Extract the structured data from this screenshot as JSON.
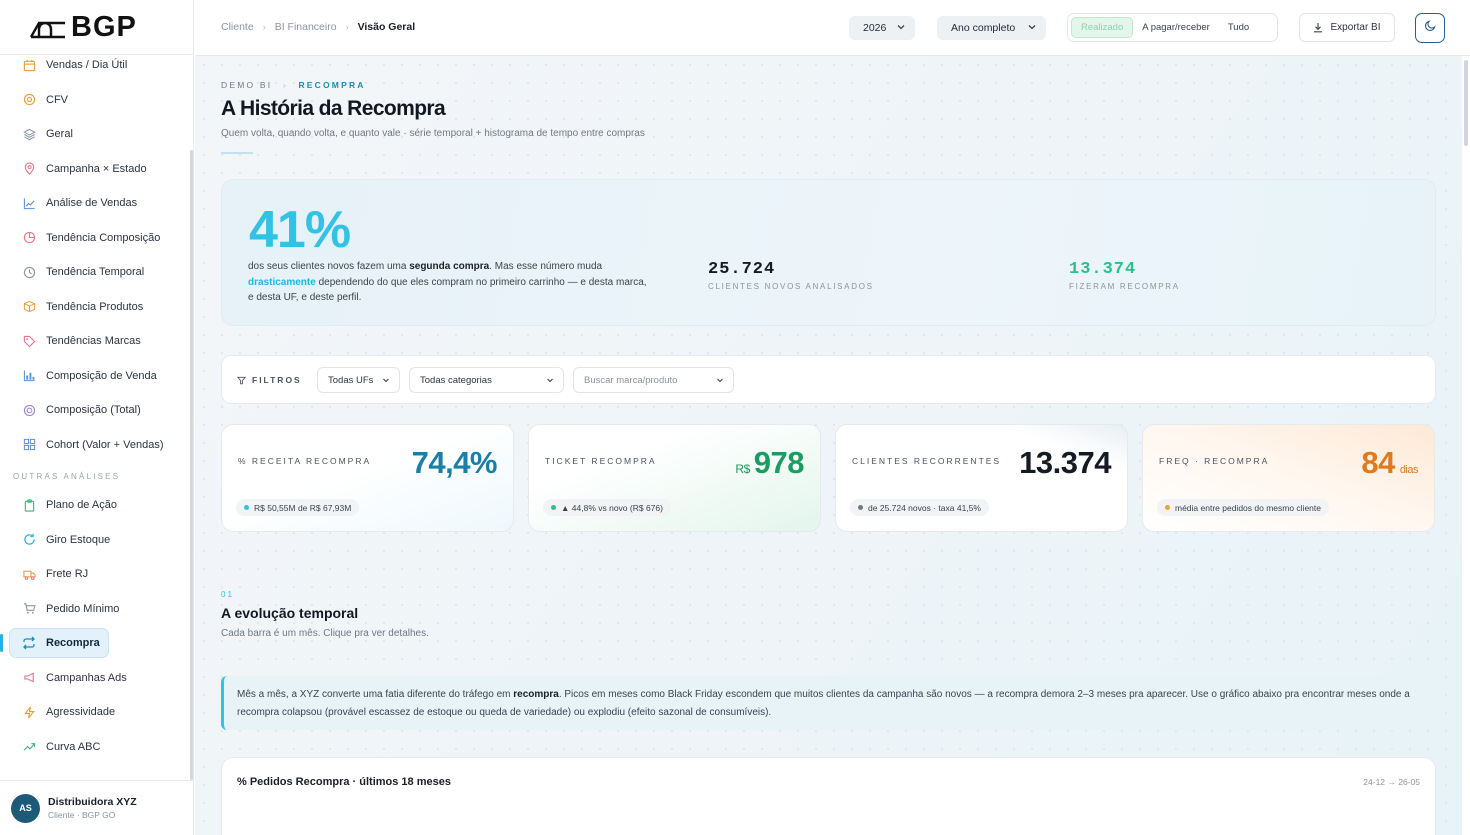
{
  "brand": {
    "logo_text": "BGP"
  },
  "sidebar": {
    "items": [
      {
        "label": "Vendas / Dia Útil",
        "icon": "calendar-icon"
      },
      {
        "label": "CFV",
        "icon": "coin-icon"
      },
      {
        "label": "Geral",
        "icon": "layers-icon"
      },
      {
        "label": "Campanha × Estado",
        "icon": "map-pin-icon"
      },
      {
        "label": "Análise de Vendas",
        "icon": "line-chart-icon"
      },
      {
        "label": "Tendência Composição",
        "icon": "pie-chart-icon"
      },
      {
        "label": "Tendência Temporal",
        "icon": "clock-icon"
      },
      {
        "label": "Tendência Produtos",
        "icon": "box-icon"
      },
      {
        "label": "Tendências Marcas",
        "icon": "tag-icon"
      },
      {
        "label": "Composição de Venda",
        "icon": "bar-chart-icon"
      },
      {
        "label": "Composição (Total)",
        "icon": "target-icon"
      },
      {
        "label": "Cohort (Valor + Vendas)",
        "icon": "grid-icon"
      }
    ],
    "section_label": "OUTRAS ANÁLISES",
    "items2": [
      {
        "label": "Plano de Ação",
        "icon": "clipboard-icon"
      },
      {
        "label": "Giro Estoque",
        "icon": "refresh-icon"
      },
      {
        "label": "Frete RJ",
        "icon": "truck-icon"
      },
      {
        "label": "Pedido Mínimo",
        "icon": "cart-icon"
      },
      {
        "label": "Recompra",
        "icon": "repeat-icon",
        "active": true
      },
      {
        "label": "Campanhas Ads",
        "icon": "megaphone-icon"
      },
      {
        "label": "Agressividade",
        "icon": "bolt-icon"
      },
      {
        "label": "Curva ABC",
        "icon": "trending-up-icon"
      }
    ],
    "user": {
      "initials": "AS",
      "name": "Distribuidora XYZ",
      "subtitle": "Cliente · BGP GO"
    }
  },
  "topbar": {
    "breadcrumb": [
      "Cliente",
      "BI Financeiro",
      "Visão Geral"
    ],
    "year": "2026",
    "period": "Ano completo",
    "segments": [
      "Realizado",
      "A pagar/receber",
      "Tudo"
    ],
    "active_segment": "Realizado",
    "export_label": "Exportar BI"
  },
  "page": {
    "eyebrow_1": "DEMO BI",
    "eyebrow_sep": "›",
    "eyebrow_2": "RECOMPRA",
    "title": "A História da Recompra",
    "subtitle": "Quem volta, quando volta, e quanto vale · série temporal + histograma de tempo entre compras"
  },
  "hero": {
    "big_value": "41%",
    "text_1": "dos seus clientes novos fazem uma ",
    "text_bold": "segunda compra",
    "text_2": ". Mas esse número muda ",
    "text_accent": "drasticamente",
    "text_3": " dependendo do que eles compram no primeiro carrinho — e desta marca, e desta UF, e deste perfil.",
    "stat1_value": "25.724",
    "stat1_label": "CLIENTES NOVOS ANALISADOS",
    "stat2_value": "13.374",
    "stat2_label": "FIZERAM RECOMPRA",
    "stat2_color": "#2bbf8a"
  },
  "filters": {
    "label": "FILTROS",
    "uf": "Todas UFs",
    "category": "Todas categorias",
    "search_placeholder": "Buscar marca/produto"
  },
  "kpis": [
    {
      "label": "% RECEITA RECOMPRA",
      "unit": "",
      "value": "74,4%",
      "suffix": "",
      "chip": "R$ 50,55M de R$ 67,93M",
      "color": "#1a7fa6",
      "dot": "#33c2e6"
    },
    {
      "label": "TICKET RECOMPRA",
      "unit": "R$",
      "value": "978",
      "suffix": "",
      "chip": "▲ 44,8% vs novo (R$ 676)",
      "color": "#1e9a62",
      "dot": "#2bbf8a"
    },
    {
      "label": "CLIENTES RECORRENTES",
      "unit": "",
      "value": "13.374",
      "suffix": "",
      "chip": "de 25.724 novos · taxa 41,5%",
      "color": "#141b24",
      "dot": "#6f7884"
    },
    {
      "label": "FREQ · RECOMPRA",
      "unit": "",
      "value": "84",
      "suffix": "dias",
      "chip": "média entre pedidos do mesmo cliente",
      "color": "#e07a1e",
      "dot": "#f0a23a"
    }
  ],
  "section": {
    "number": "01",
    "title": "A evolução temporal",
    "subtitle": "Cada barra é um mês. Clique pra ver detalhes."
  },
  "callout": {
    "t1": "Mês a mês, a XYZ converte uma fatia diferente do tráfego em ",
    "bold": "recompra",
    "t2": ". Picos em meses como Black Friday escondem que muitos clientes da campanha são novos — a recompra demora 2–3 meses pra aparecer. Use o gráfico abaixo pra encontrar meses onde a recompra colapsou (provável escassez de estoque ou queda de variedade) ou explodiu (efeito sazonal de consumíveis)."
  },
  "chart_card": {
    "title": "% Pedidos Recompra · últimos 18 meses",
    "range": "24-12 → 26-05"
  }
}
